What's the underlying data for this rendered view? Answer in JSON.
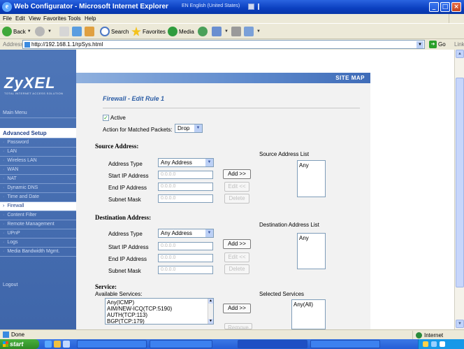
{
  "window": {
    "title": "Web Configurator - Microsoft Internet Explorer",
    "language": "EN English (United States)"
  },
  "menu": [
    "File",
    "Edit",
    "View",
    "Favorites",
    "Tools",
    "Help"
  ],
  "toolbar": {
    "back": "Back",
    "search": "Search",
    "favorites": "Favorites",
    "media": "Media"
  },
  "address": {
    "label": "Address",
    "url": "http://192.168.1.1/rpSys.html",
    "go": "Go",
    "links": "Links"
  },
  "brand": {
    "name": "ZyXEL",
    "tagline": "TOTAL INTERNET ACCESS SOLUTION"
  },
  "sidebar": {
    "main_menu": "Main Menu",
    "advanced_setup": "Advanced Setup",
    "items": [
      "Password",
      "LAN",
      "Wireless LAN",
      "WAN",
      "NAT",
      "Dynamic DNS",
      "Time and Date",
      "Firewall",
      "Content Filter",
      "Remote Management",
      "UPnP",
      "Logs",
      "Media Bandwidth Mgmt."
    ],
    "logout": "Logout"
  },
  "header": {
    "site_map": "SITE MAP"
  },
  "form": {
    "title": "Firewall - Edit Rule 1",
    "active_label": "Active",
    "action_label": "Action for Matched Packets:",
    "action_value": "Drop",
    "source": {
      "heading": "Source Address:",
      "list_label": "Source Address List",
      "list_items": [
        "Any"
      ],
      "address_type_label": "Address Type",
      "address_type_value": "Any Address",
      "start_ip_label": "Start IP Address",
      "start_ip_value": "0.0.0.0",
      "end_ip_label": "End IP Address",
      "end_ip_value": "0.0.0.0",
      "subnet_label": "Subnet Mask",
      "subnet_value": "0.0.0.0",
      "add_button": "Add >>",
      "edit_button": "Edit <<",
      "delete_button": "Delete"
    },
    "destination": {
      "heading": "Destination Address:",
      "list_label": "Destination Address List",
      "list_items": [
        "Any"
      ],
      "address_type_label": "Address Type",
      "address_type_value": "Any Address",
      "start_ip_label": "Start IP Address",
      "start_ip_value": "0.0.0.0",
      "end_ip_label": "End IP Address",
      "end_ip_value": "0.0.0.0",
      "subnet_label": "Subnet Mask",
      "subnet_value": "0.0.0.0",
      "add_button": "Add >>",
      "edit_button": "Edit <<",
      "delete_button": "Delete"
    },
    "service": {
      "heading": "Service:",
      "available_label": "Available Services:",
      "available": [
        "Any(ICMP)",
        "AIM/NEW-ICQ(TCP:5190)",
        "AUTH(TCP:113)",
        "BGP(TCP:179)"
      ],
      "selected_label": "Selected Services",
      "selected": [
        "Any(All)"
      ],
      "add_button": "Add >>",
      "remove_button": "Remove"
    }
  },
  "status": {
    "text": "Done",
    "zone": "Internet"
  },
  "taskbar": {
    "start": "start"
  },
  "colors": {
    "accent": "#2e5fa6",
    "sidebar": "#4e76b8",
    "titlebar": "#0a3fbf"
  }
}
